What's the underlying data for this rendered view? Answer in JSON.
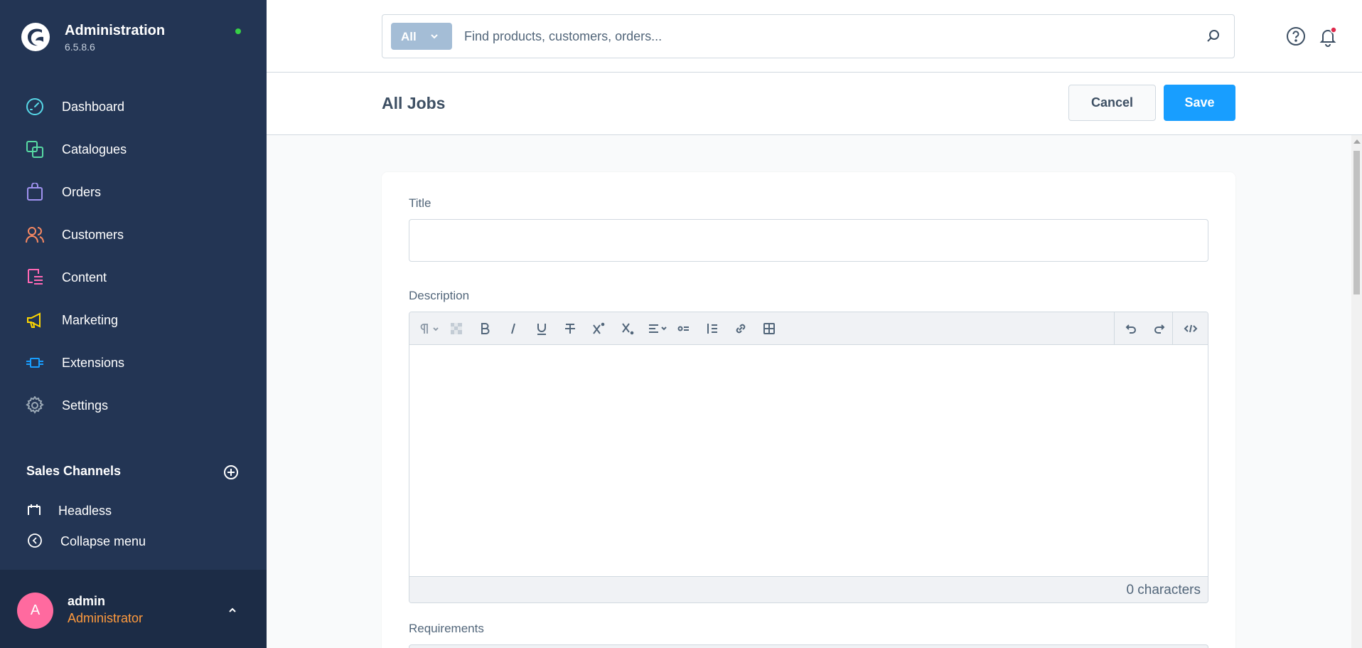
{
  "brand": {
    "title": "Administration",
    "version": "6.5.8.6"
  },
  "nav": {
    "items": [
      {
        "label": "Dashboard",
        "icon": "dashboard-icon",
        "color": "#57d9e8"
      },
      {
        "label": "Catalogues",
        "icon": "catalogues-icon",
        "color": "#57d9a3"
      },
      {
        "label": "Orders",
        "icon": "orders-icon",
        "color": "#a092f0"
      },
      {
        "label": "Customers",
        "icon": "customers-icon",
        "color": "#f88962"
      },
      {
        "label": "Content",
        "icon": "content-icon",
        "color": "#ff68b4"
      },
      {
        "label": "Marketing",
        "icon": "marketing-icon",
        "color": "#ffd700"
      },
      {
        "label": "Extensions",
        "icon": "extensions-icon",
        "color": "#189eff"
      },
      {
        "label": "Settings",
        "icon": "settings-icon",
        "color": "#9aa8b5"
      }
    ]
  },
  "sales_channels": {
    "heading": "Sales Channels",
    "items": [
      "Headless"
    ]
  },
  "collapse": {
    "label": "Collapse menu"
  },
  "user": {
    "initial": "A",
    "name": "admin",
    "role": "Administrator"
  },
  "search": {
    "type_label": "All",
    "placeholder": "Find products, customers, orders..."
  },
  "page": {
    "title": "All Jobs",
    "cancel_label": "Cancel",
    "save_label": "Save"
  },
  "form": {
    "title_label": "Title",
    "title_value": "",
    "description_label": "Description",
    "char_count": "0 characters",
    "requirements_label": "Requirements"
  },
  "colors": {
    "sidebar": "#233554",
    "accent": "#189eff",
    "status_online": "#37d046",
    "role": "#ff9a3d",
    "avatar": "#ff6a9f"
  }
}
